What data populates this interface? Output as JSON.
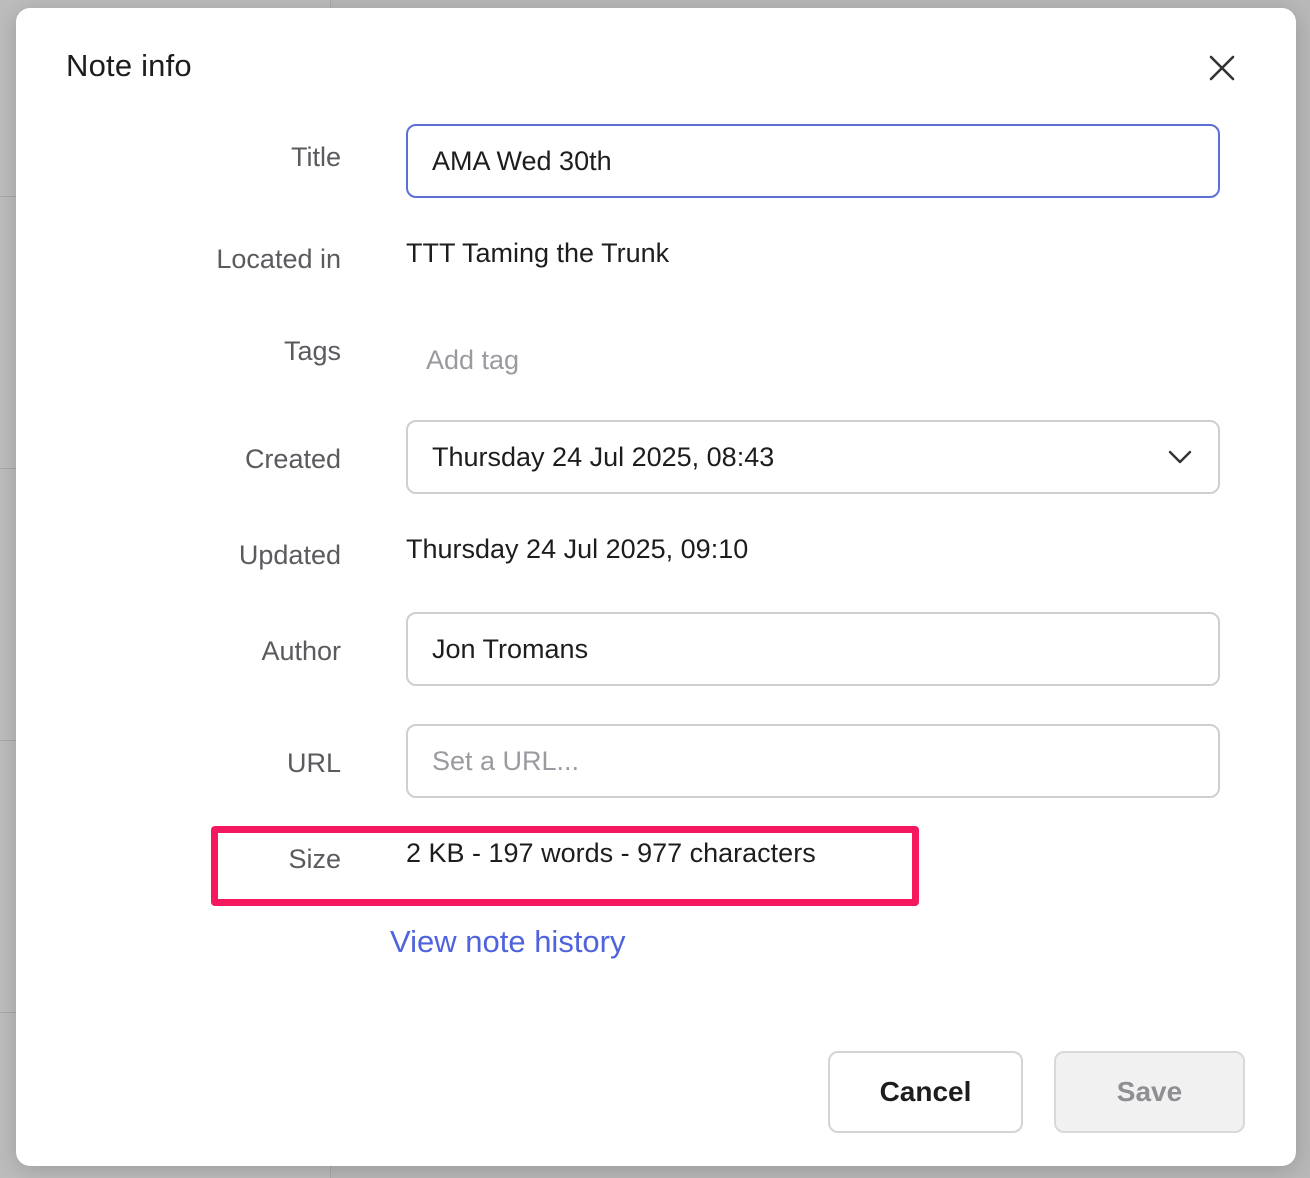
{
  "dialog": {
    "title": "Note info"
  },
  "fields": {
    "title": {
      "label": "Title",
      "value": "AMA Wed 30th"
    },
    "located_in": {
      "label": "Located in",
      "value": "TTT Taming the Trunk"
    },
    "tags": {
      "label": "Tags",
      "placeholder": "Add tag"
    },
    "created": {
      "label": "Created",
      "value": "Thursday 24 Jul 2025, 08:43"
    },
    "updated": {
      "label": "Updated",
      "value": "Thursday 24 Jul 2025, 09:10"
    },
    "author": {
      "label": "Author",
      "value": "Jon Tromans"
    },
    "url": {
      "label": "URL",
      "value": "",
      "placeholder": "Set a URL..."
    },
    "size": {
      "label": "Size",
      "value": "2 KB - 197 words - 977 characters"
    }
  },
  "links": {
    "history": "View note history"
  },
  "buttons": {
    "cancel": "Cancel",
    "save": "Save"
  },
  "colors": {
    "accent": "#4f63dd",
    "focus_border": "#5b6fd6",
    "highlight": "#f5185f"
  }
}
